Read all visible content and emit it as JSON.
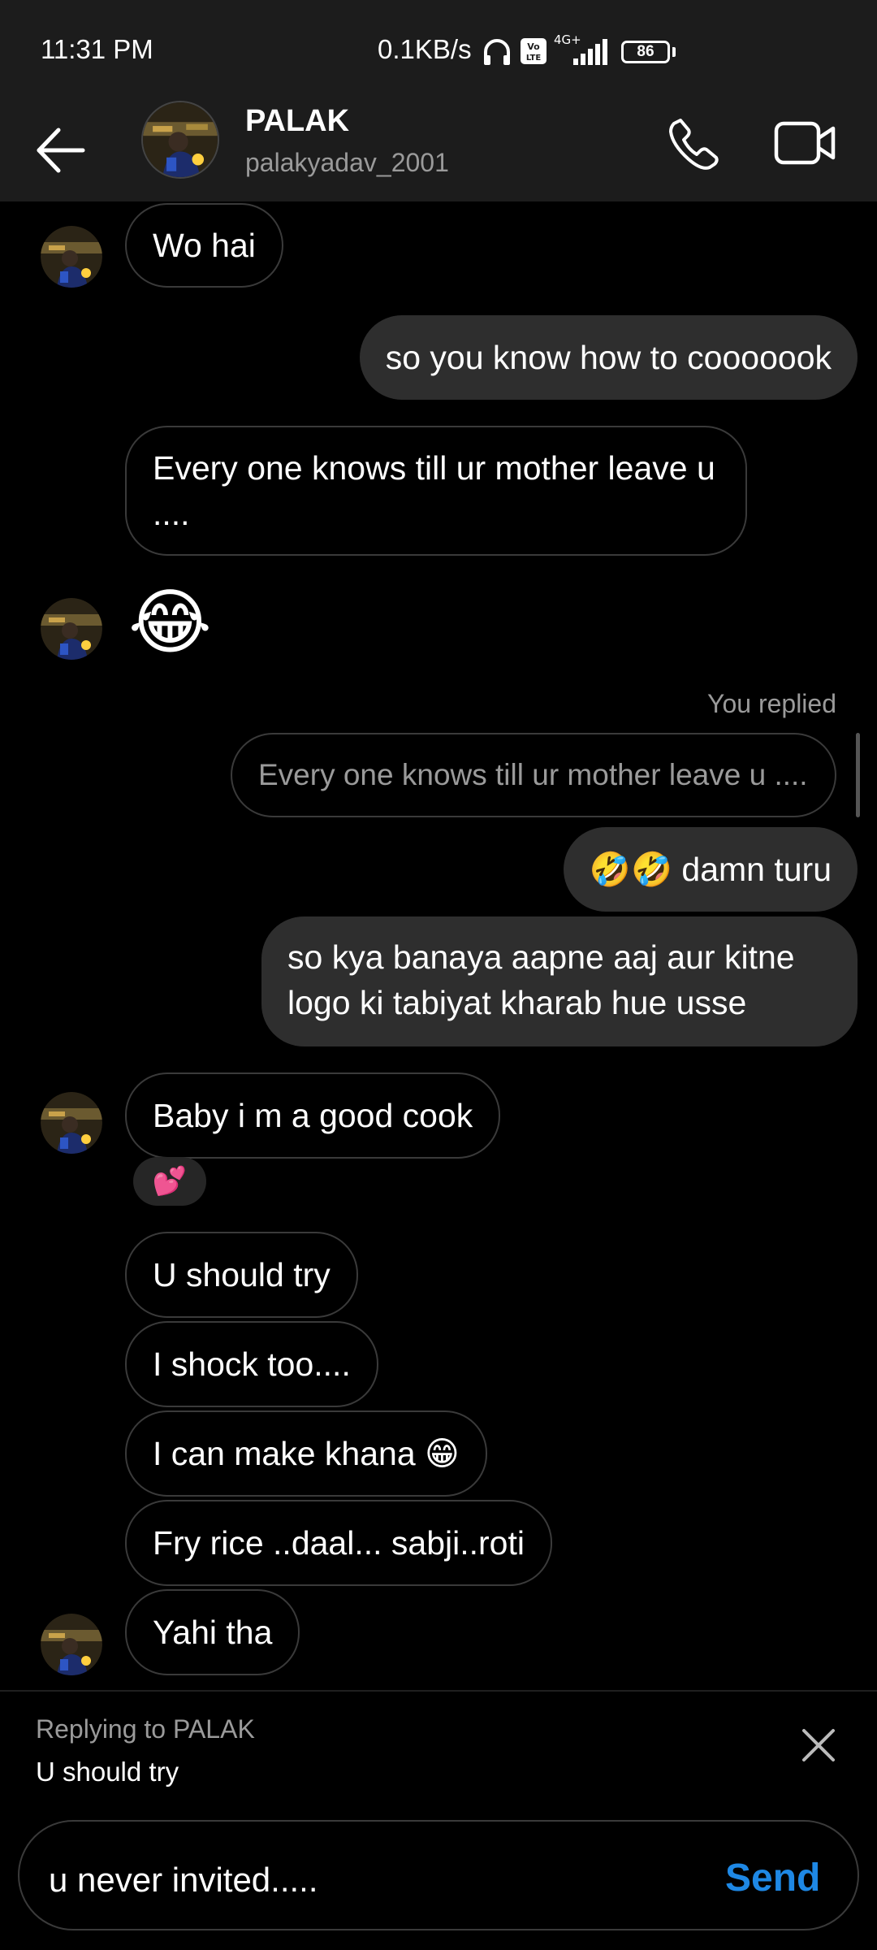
{
  "status_bar": {
    "time": "11:31 PM",
    "network_speed": "0.1KB/s",
    "battery": "86",
    "network_type": "4G+"
  },
  "header": {
    "name": "PALAK",
    "username": "palakyadav_2001"
  },
  "messages": [
    {
      "text": "Wo hai",
      "side": "incoming"
    },
    {
      "text": "so you know how to cooooook",
      "side": "outgoing"
    },
    {
      "text": "Every one knows till ur mother leave u ....",
      "side": "incoming"
    },
    {
      "text": "😂",
      "side": "incoming"
    },
    {
      "text": "You replied",
      "side": "meta"
    },
    {
      "text": "Every one knows till ur mother leave u ....",
      "side": "quoted"
    },
    {
      "text": "🤣🤣 damn turu",
      "side": "outgoing"
    },
    {
      "text": "so kya banaya aapne aaj aur kitne logo ki tabiyat kharab hue usse",
      "side": "outgoing"
    },
    {
      "text": "Baby i m a good cook",
      "side": "incoming"
    },
    {
      "text": "💕",
      "side": "reaction"
    },
    {
      "text": "U should try",
      "side": "incoming"
    },
    {
      "text": "I shock too....",
      "side": "incoming"
    },
    {
      "text": "I can make khana 😁",
      "side": "incoming"
    },
    {
      "text": "Fry rice ..daal... sabji..roti",
      "side": "incoming"
    },
    {
      "text": "Yahi tha",
      "side": "incoming"
    }
  ],
  "reply": {
    "label": "Replying to PALAK",
    "text": "U should try"
  },
  "composer": {
    "value": "u never invited.....",
    "send_label": "Send"
  },
  "colors": {
    "send": "#1e88e5",
    "outgoing_bubble": "#2e2e2e",
    "header_bg": "#1c1c1c"
  }
}
